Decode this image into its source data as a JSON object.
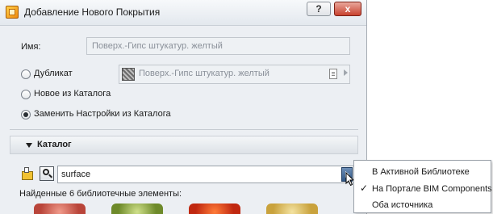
{
  "window": {
    "title": "Добавление Нового Покрытия",
    "help_label": "?",
    "close_label": "x"
  },
  "name_label": "Имя:",
  "name_value": "Поверх.-Гипс штукатур. желтый",
  "options": [
    {
      "label": "Дубликат",
      "selected": false
    },
    {
      "label": "Новое из Каталога",
      "selected": false
    },
    {
      "label": "Заменить Настройки из Каталога",
      "selected": true
    }
  ],
  "duplicate_value": "Поверх.-Гипс штукатур. желтый",
  "catalog": {
    "header": "Каталог",
    "search_value": "surface",
    "found_text": "Найденные 6 библиотечные элементы:"
  },
  "source_menu": {
    "items": [
      {
        "label": "В Активной Библиотеке",
        "checked": false
      },
      {
        "label": "На Портале BIM Components",
        "checked": true
      },
      {
        "label": "Оба источника",
        "checked": false
      }
    ],
    "check_glyph": "✓"
  }
}
